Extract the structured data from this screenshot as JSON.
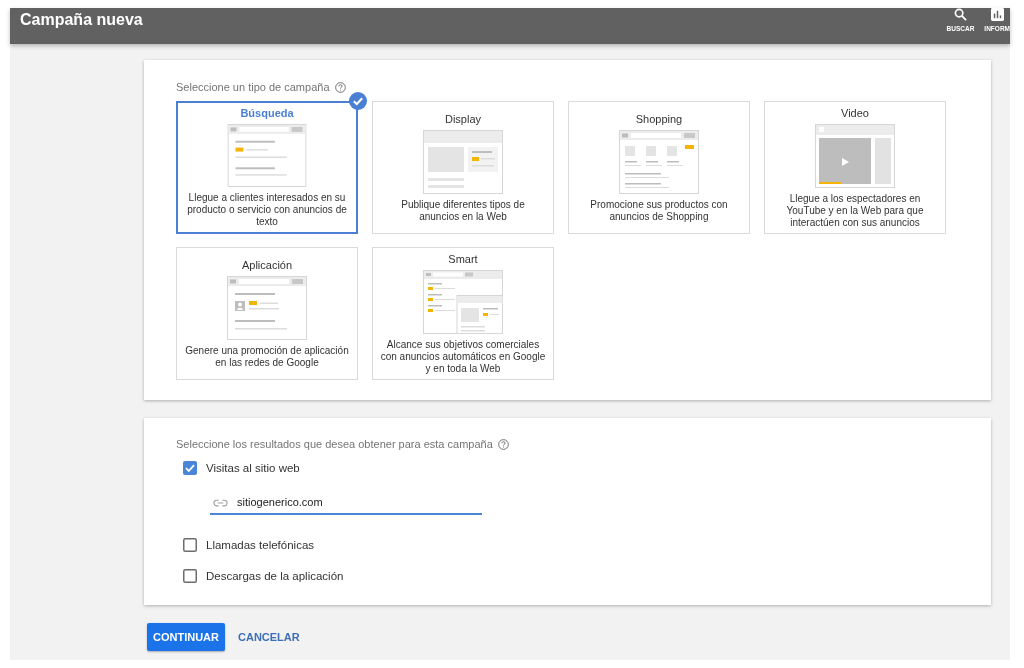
{
  "header": {
    "title": "Campaña nueva",
    "actions": [
      {
        "kind": "search",
        "label": "BUSCAR"
      },
      {
        "kind": "reports",
        "label": "INFORM"
      }
    ]
  },
  "campaign_types": {
    "heading": "Seleccione un tipo de campaña",
    "types": [
      {
        "kind": "search",
        "name": "Búsqueda",
        "description": "Llegue a clientes interesados en su producto o servicio con anuncios de texto",
        "selected": true
      },
      {
        "kind": "display",
        "name": "Display",
        "description": "Publique diferentes tipos de anuncios en la Web",
        "selected": false
      },
      {
        "kind": "shopping",
        "name": "Shopping",
        "description": "Promocione sus productos con anuncios de Shopping",
        "selected": false
      },
      {
        "kind": "video",
        "name": "Video",
        "description": "Llegue a los espectadores en YouTube y en la Web para que interactúen con sus anuncios",
        "selected": false
      },
      {
        "kind": "app",
        "name": "Aplicación",
        "description": "Genere una promoción de aplicación en las redes de Google",
        "selected": false
      },
      {
        "kind": "smart",
        "name": "Smart",
        "description": "Alcance sus objetivos comerciales con anuncios automáticos en Google y en toda la Web",
        "selected": false
      }
    ]
  },
  "goals": {
    "heading": "Seleccione los resultados que desea obtener para esta campaña",
    "options": [
      {
        "label": "Visitas al sitio web",
        "checked": true,
        "field": {
          "value": "sitiogenerico.com"
        }
      },
      {
        "label": "Llamadas telefónicas",
        "checked": false
      },
      {
        "label": "Descargas de la aplicación",
        "checked": false
      }
    ]
  },
  "buttons": [
    {
      "kind": "primary",
      "label": "CONTINUAR"
    },
    {
      "kind": "text",
      "label": "CANCELAR"
    }
  ]
}
